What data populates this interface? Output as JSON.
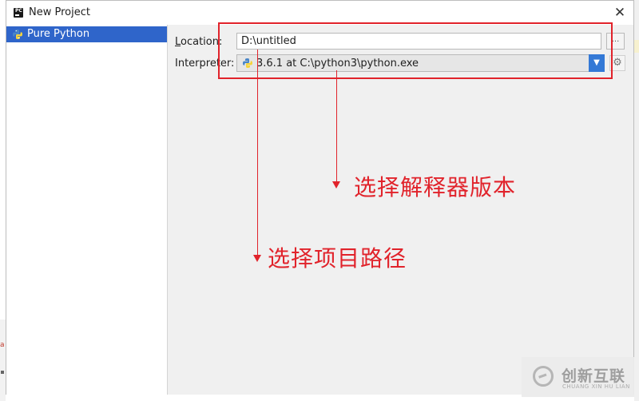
{
  "dialog": {
    "title": "New Project",
    "close_glyph": "✕"
  },
  "sidebar": {
    "items": [
      {
        "label": "Pure Python",
        "icon": "python-icon",
        "selected": true
      }
    ]
  },
  "form": {
    "location_label_underlined": "L",
    "location_label_rest": "ocation:",
    "location_value": "D:\\untitled",
    "browse_label": "...",
    "interpreter_label": "Interpreter:",
    "interpreter_value": "3.6.1 at C:\\python3\\python.exe",
    "dropdown_glyph": "▼",
    "gear_glyph": "⚙"
  },
  "annotations": {
    "interpreter_note": "选择解释器版本",
    "location_note": "选择项目路径"
  },
  "watermark": {
    "brand_cn": "创新互联",
    "brand_en": "CHUANG XIN HU LIAN"
  },
  "colors": {
    "selection": "#2f65ca",
    "annotation_red": "#e1232b",
    "dropdown_blue": "#3479d6"
  }
}
